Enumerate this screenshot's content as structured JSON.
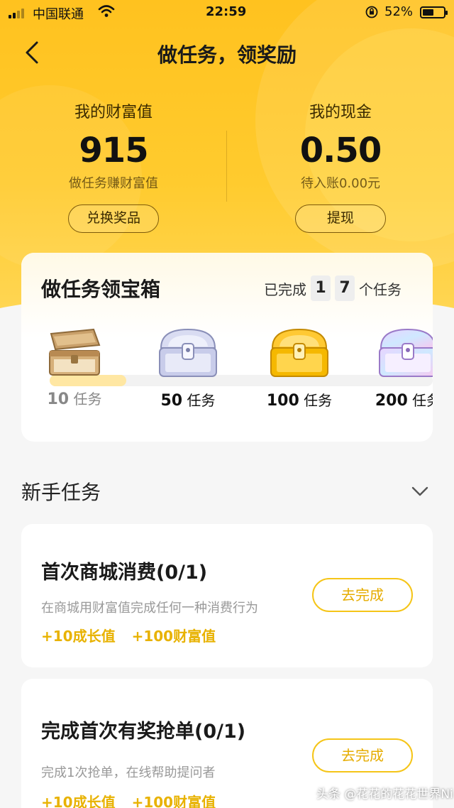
{
  "status_bar": {
    "carrier": "中国联通",
    "time": "22:59",
    "battery_percent": "52%",
    "battery_level": 0.52,
    "icons": [
      "signal-icon",
      "wifi-icon",
      "orientation-lock-icon",
      "battery-icon"
    ]
  },
  "header": {
    "title": "做任务，领奖励",
    "back_icon": "back-icon"
  },
  "colors": {
    "hero_yellow": "#ffc21f",
    "accent_yellow": "#f5c518",
    "reward_text": "#e8b200",
    "page_bg": "#f6f6f6"
  },
  "wealth": {
    "label": "我的财富值",
    "value": "915",
    "sub": "做任务赚财富值",
    "button": "兑换奖品"
  },
  "cash": {
    "label": "我的现金",
    "value": "0.50",
    "sub": "待入账0.00元",
    "button": "提现"
  },
  "treasure": {
    "title": "做任务领宝箱",
    "progress_prefix": "已完成",
    "digits": [
      "1",
      "7"
    ],
    "progress_suffix": "个任务",
    "progress_fraction": 0.17,
    "chests": [
      {
        "count": "10",
        "unit": "任务",
        "state": "opened",
        "icon": "open-wooden-chest-icon"
      },
      {
        "count": "50",
        "unit": "任务",
        "state": "locked",
        "icon": "silver-chest-icon"
      },
      {
        "count": "100",
        "unit": "任务",
        "state": "locked",
        "icon": "gold-chest-icon"
      },
      {
        "count": "200",
        "unit": "任务",
        "state": "locked",
        "icon": "diamond-chest-icon"
      }
    ]
  },
  "newbie": {
    "title": "新手任务",
    "toggle_icon": "chevron-down-icon",
    "tasks": [
      {
        "title": "首次商城消费(0/1)",
        "desc": "在商城用财富值完成任何一种消费行为",
        "rewards": [
          "+10成长值",
          "+100财富值"
        ],
        "button": "去完成"
      },
      {
        "title": "完成首次有奖抢单(0/1)",
        "desc": "完成1次抢单，在线帮助提问者",
        "rewards": [
          "+10成长值",
          "+100财富值"
        ],
        "button": "去完成"
      }
    ]
  },
  "watermark": "头条 @花花的花花世界Ni"
}
